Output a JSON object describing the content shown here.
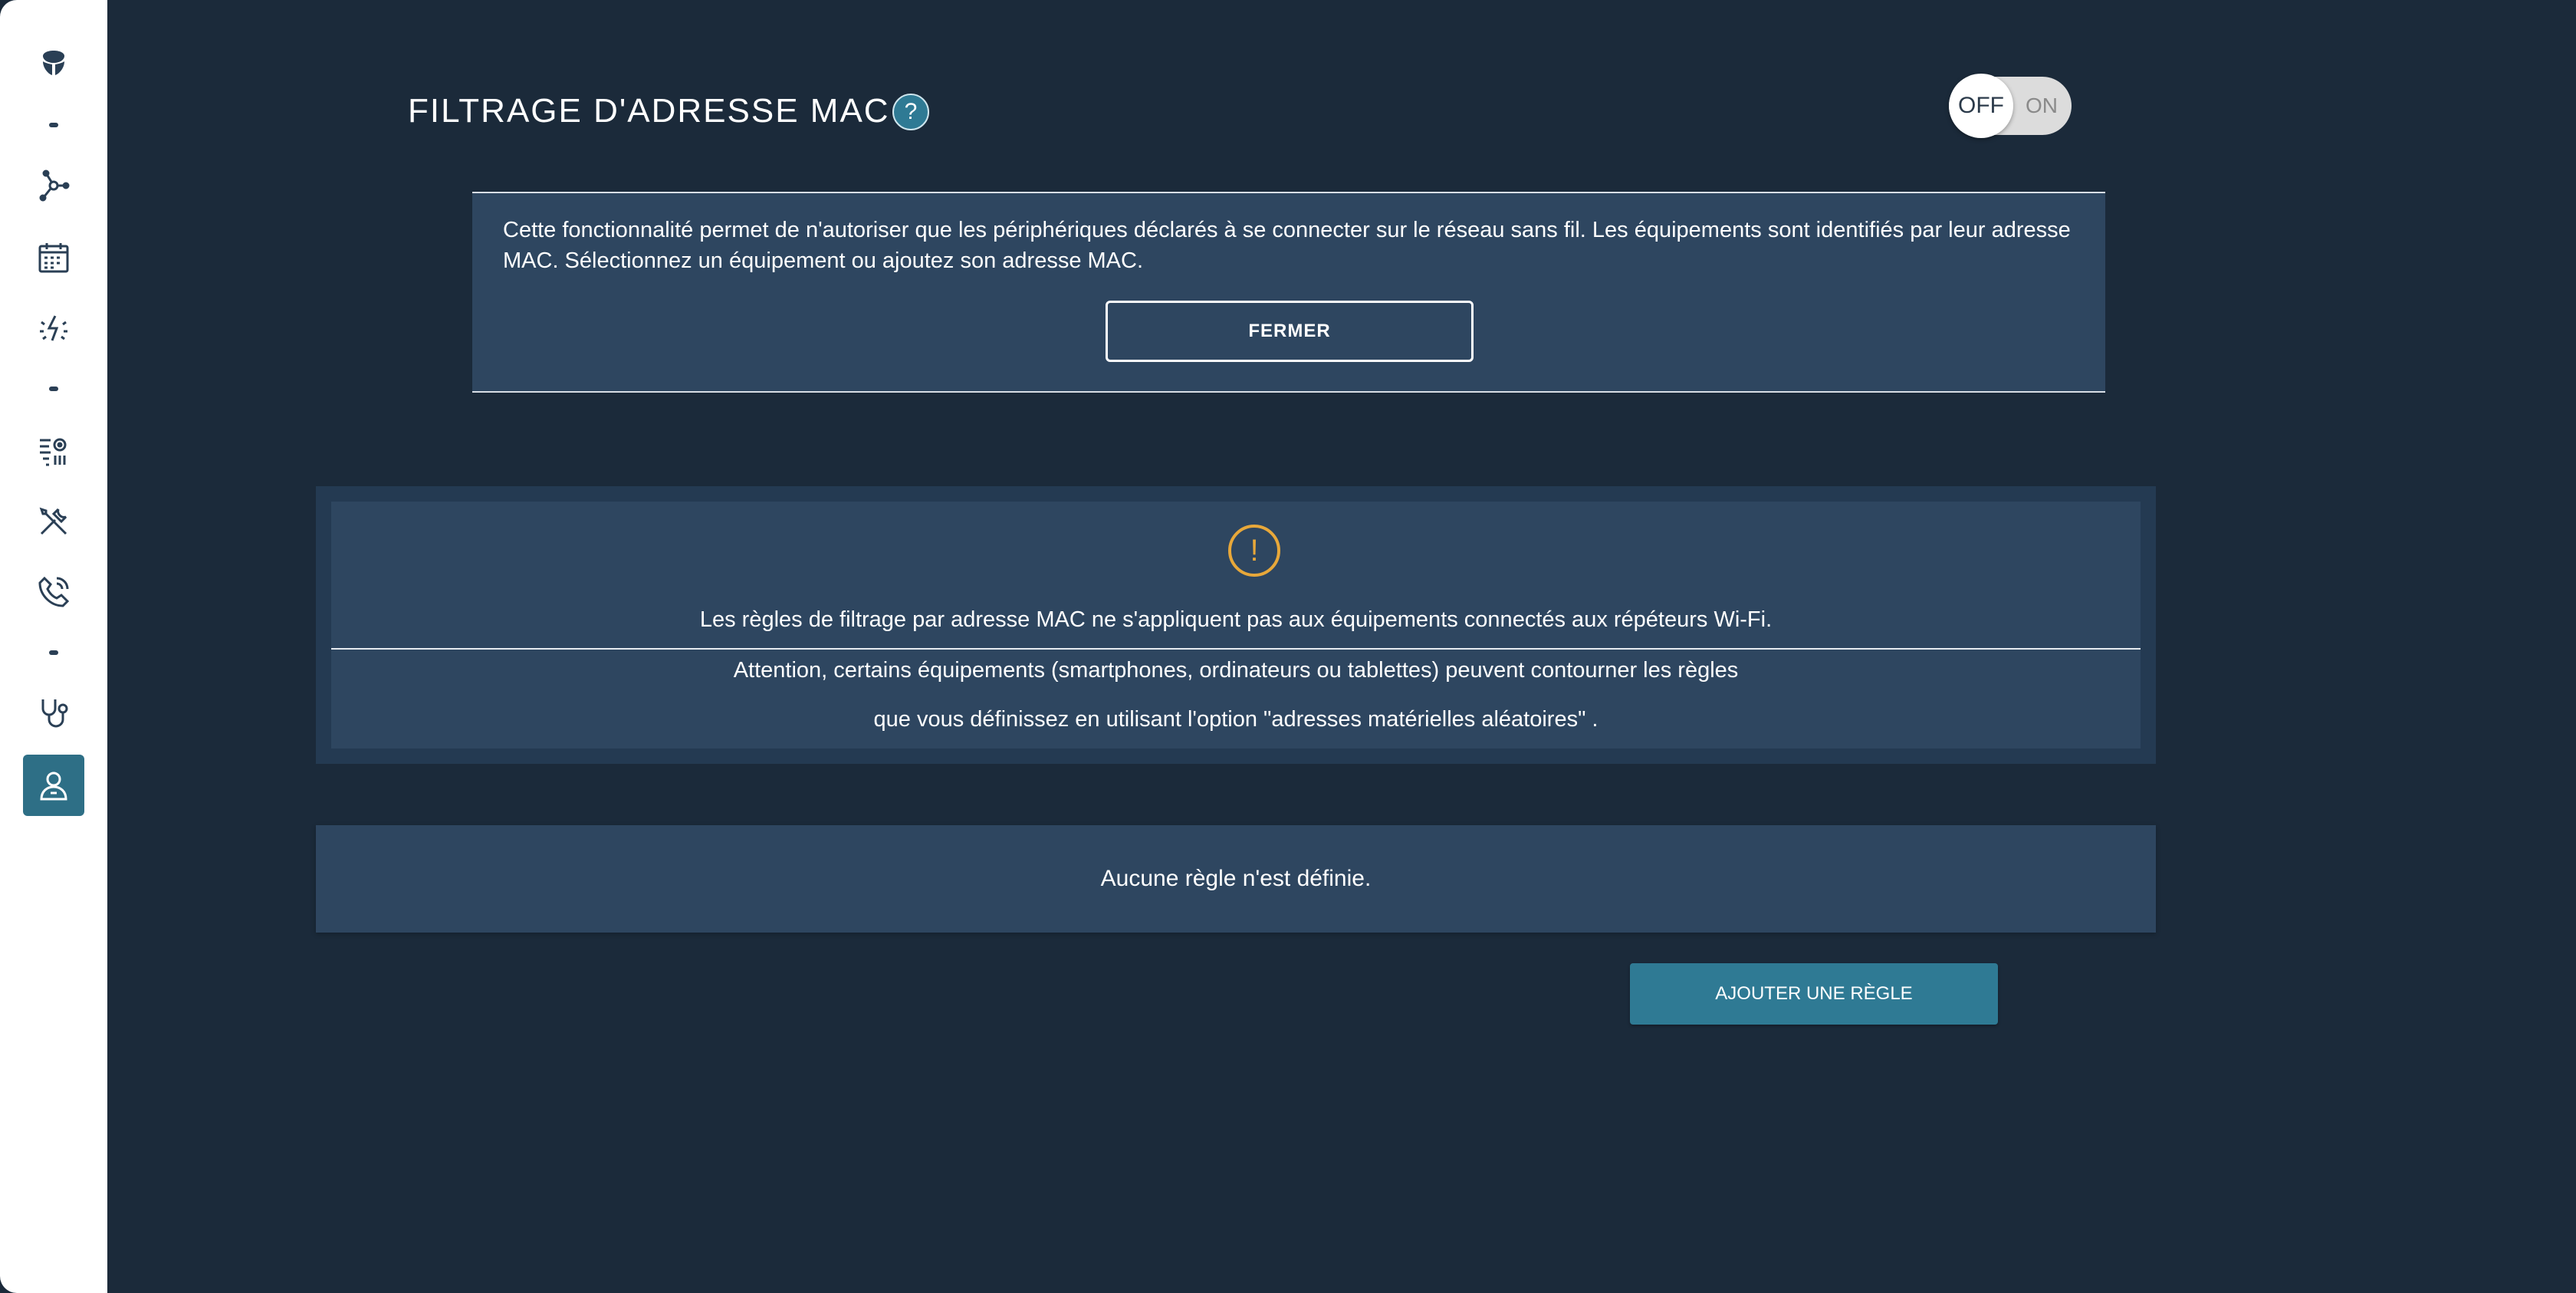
{
  "sidebar": {
    "items": [
      {
        "icon": "brand-logo-icon"
      },
      {
        "icon": "network-icon"
      },
      {
        "icon": "calendar-icon"
      },
      {
        "icon": "wifi-settings-icon"
      },
      {
        "icon": "parameters-icon"
      },
      {
        "icon": "tools-icon"
      },
      {
        "icon": "phone-icon"
      },
      {
        "icon": "diagnostic-icon"
      },
      {
        "icon": "user-icon",
        "active": true
      }
    ]
  },
  "header": {
    "title": "FILTRAGE D'ADRESSE MAC",
    "help_label": "?",
    "toggle": {
      "off_label": "OFF",
      "on_label": "ON",
      "state": "OFF"
    }
  },
  "info": {
    "text": "Cette fonctionnalité permet de n'autoriser que les périphériques déclarés à se connecter sur le réseau sans fil. Les équipements sont identifiés par leur adresse MAC. Sélectionnez un équipement ou ajoutez son adresse MAC.",
    "close_label": "FERMER"
  },
  "warning": {
    "icon_label": "!",
    "line1": "Les règles de filtrage par adresse MAC ne s'appliquent pas aux équipements connectés aux répéteurs Wi-Fi.",
    "line2": "Attention, certains équipements (smartphones, ordinateurs ou tablettes) peuvent contourner les règles",
    "line3": "que vous définissez en utilisant l'option \"adresses matérielles aléatoires\" ."
  },
  "rules": {
    "empty_text": "Aucune règle n'est définie.",
    "add_label": "AJOUTER UNE RÈGLE"
  },
  "colors": {
    "background": "#1b2a3a",
    "panel": "#2e4660",
    "accent": "#2f7a94",
    "warning": "#e8a83a"
  }
}
